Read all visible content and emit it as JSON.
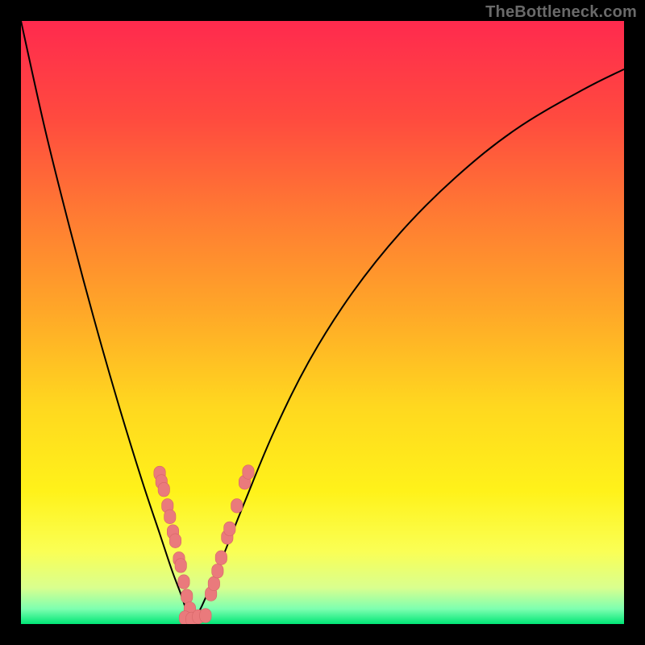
{
  "watermark": "TheBottleneck.com",
  "colors": {
    "frame": "#000000",
    "curve": "#000000",
    "dot_fill": "#ea7a7c",
    "dot_stroke": "#d66567",
    "gradient_stops": [
      {
        "offset": 0.0,
        "color": "#ff2a4e"
      },
      {
        "offset": 0.16,
        "color": "#ff4a3f"
      },
      {
        "offset": 0.32,
        "color": "#ff7a33"
      },
      {
        "offset": 0.48,
        "color": "#ffa728"
      },
      {
        "offset": 0.64,
        "color": "#ffd81f"
      },
      {
        "offset": 0.78,
        "color": "#fff21a"
      },
      {
        "offset": 0.88,
        "color": "#faff55"
      },
      {
        "offset": 0.94,
        "color": "#d9ff8f"
      },
      {
        "offset": 0.975,
        "color": "#7dffb0"
      },
      {
        "offset": 1.0,
        "color": "#00e676"
      }
    ]
  },
  "chart_data": {
    "type": "line",
    "title": "",
    "xlabel": "",
    "ylabel": "",
    "xlim": [
      0,
      1
    ],
    "ylim": [
      0,
      1
    ],
    "note": "No axis ticks or numeric labels are visible; x/y are normalized to the plot area. y=0 is the bottom green band, y=1 is the top.",
    "series": [
      {
        "name": "left-branch",
        "x": [
          0.0,
          0.04,
          0.08,
          0.12,
          0.16,
          0.2,
          0.23,
          0.25,
          0.265,
          0.275,
          0.283
        ],
        "y": [
          1.0,
          0.82,
          0.66,
          0.51,
          0.37,
          0.24,
          0.15,
          0.09,
          0.05,
          0.02,
          0.0
        ]
      },
      {
        "name": "right-branch",
        "x": [
          0.283,
          0.3,
          0.33,
          0.37,
          0.42,
          0.48,
          0.55,
          0.63,
          0.72,
          0.82,
          0.93,
          1.0
        ],
        "y": [
          0.0,
          0.03,
          0.1,
          0.2,
          0.32,
          0.44,
          0.55,
          0.65,
          0.74,
          0.82,
          0.885,
          0.92
        ]
      }
    ],
    "scatter_clusters": [
      {
        "name": "left-cluster",
        "points": [
          {
            "x": 0.23,
            "y": 0.25
          },
          {
            "x": 0.233,
            "y": 0.236
          },
          {
            "x": 0.237,
            "y": 0.223
          },
          {
            "x": 0.243,
            "y": 0.196
          },
          {
            "x": 0.247,
            "y": 0.178
          },
          {
            "x": 0.252,
            "y": 0.153
          },
          {
            "x": 0.256,
            "y": 0.138
          },
          {
            "x": 0.262,
            "y": 0.108
          },
          {
            "x": 0.265,
            "y": 0.097
          },
          {
            "x": 0.27,
            "y": 0.07
          },
          {
            "x": 0.275,
            "y": 0.046
          },
          {
            "x": 0.28,
            "y": 0.025
          }
        ]
      },
      {
        "name": "bottom-cluster",
        "points": [
          {
            "x": 0.272,
            "y": 0.01
          },
          {
            "x": 0.283,
            "y": 0.008
          },
          {
            "x": 0.294,
            "y": 0.012
          },
          {
            "x": 0.306,
            "y": 0.014
          }
        ]
      },
      {
        "name": "right-cluster",
        "points": [
          {
            "x": 0.315,
            "y": 0.05
          },
          {
            "x": 0.32,
            "y": 0.067
          },
          {
            "x": 0.326,
            "y": 0.088
          },
          {
            "x": 0.332,
            "y": 0.11
          },
          {
            "x": 0.342,
            "y": 0.144
          },
          {
            "x": 0.346,
            "y": 0.158
          },
          {
            "x": 0.358,
            "y": 0.196
          },
          {
            "x": 0.371,
            "y": 0.235
          },
          {
            "x": 0.377,
            "y": 0.252
          }
        ]
      }
    ]
  }
}
